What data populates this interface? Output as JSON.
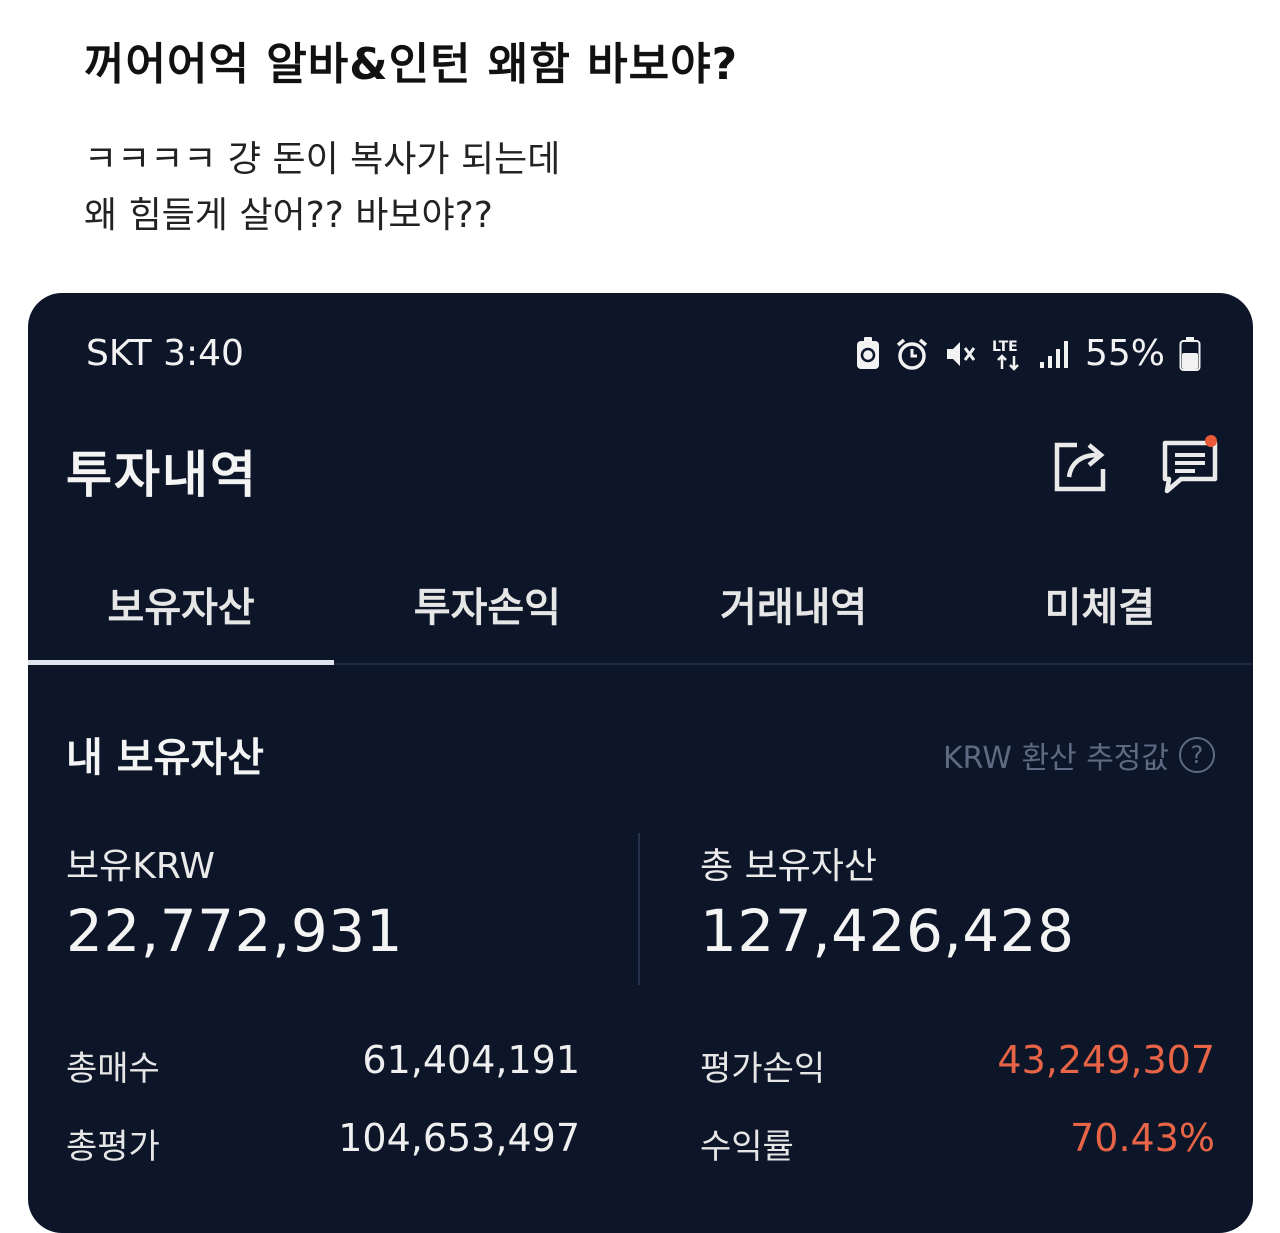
{
  "post": {
    "title": "꺼어어억 알바&인턴 왜함 바보야?",
    "body_lines": [
      "ㅋㅋㅋㅋ 걍 돈이 복사가 되는데",
      "왜 힘들게 살어?? 바보야??"
    ]
  },
  "status_bar": {
    "carrier_time": "SKT 3:40",
    "network": "LTE",
    "battery": "55%"
  },
  "header": {
    "title": "투자내역"
  },
  "tabs": [
    {
      "label": "보유자산",
      "active": true
    },
    {
      "label": "투자손익",
      "active": false
    },
    {
      "label": "거래내역",
      "active": false
    },
    {
      "label": "미체결",
      "active": false
    }
  ],
  "assets": {
    "section_title": "내 보유자산",
    "note": "KRW 환산 추정값",
    "krw_label": "보유KRW",
    "krw_value": "22,772,931",
    "total_label": "총 보유자산",
    "total_value": "127,426,428",
    "rows": {
      "total_buy_label": "총매수",
      "total_buy_value": "61,404,191",
      "total_eval_label": "총평가",
      "total_eval_value": "104,653,497",
      "pnl_label": "평가손익",
      "pnl_value": "43,249,307",
      "return_label": "수익률",
      "return_value": "70.43%"
    }
  },
  "colors": {
    "background": "#0d1629",
    "profit": "#e86446",
    "muted": "#5f6a82"
  }
}
